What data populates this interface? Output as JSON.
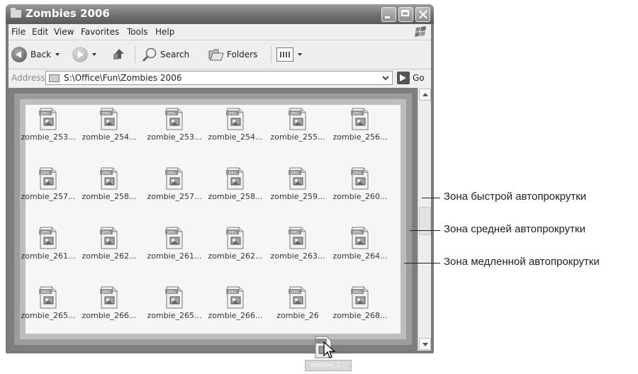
{
  "window": {
    "title": "Zombies 2006",
    "menu": [
      "File",
      "Edit",
      "View",
      "Favorites",
      "Tools",
      "Help"
    ]
  },
  "toolbar": {
    "back_label": "Back",
    "search_label": "Search",
    "folders_label": "Folders"
  },
  "address": {
    "label": "Address",
    "path": "S:\\Office\\Fun\\Zombies 2006",
    "go_label": "Go"
  },
  "files": {
    "icon": "jpeg-file-icon",
    "rows": [
      [
        "zombie_253...",
        "zombie_254...",
        "zombie_253...",
        "zombie_254...",
        "zombie_255...",
        "zombie_256..."
      ],
      [
        "zombie_257...",
        "zombie_258...",
        "zombie_257...",
        "zombie_258...",
        "zombie_259...",
        "zombie_260..."
      ],
      [
        "zombie_261...",
        "zombie_262...",
        "zombie_261...",
        "zombie_262...",
        "zombie_263...",
        "zombie_264..."
      ],
      [
        "zombie_265...",
        "zombie_266...",
        "zombie_265...",
        "zombie_266...",
        "zombie_26",
        "zombie_268..."
      ]
    ]
  },
  "dragged_item": {
    "label": "zombie_2..."
  },
  "callouts": {
    "fast": "Зона быстрой автопрокрутки",
    "medium": "Зона средней автопрокрутки",
    "slow": "Зона медленной автопрокрутки"
  },
  "colors": {
    "zone_fast": "#7e7e7e",
    "zone_medium": "#9c9c9c",
    "zone_slow": "#bdbdbd"
  }
}
